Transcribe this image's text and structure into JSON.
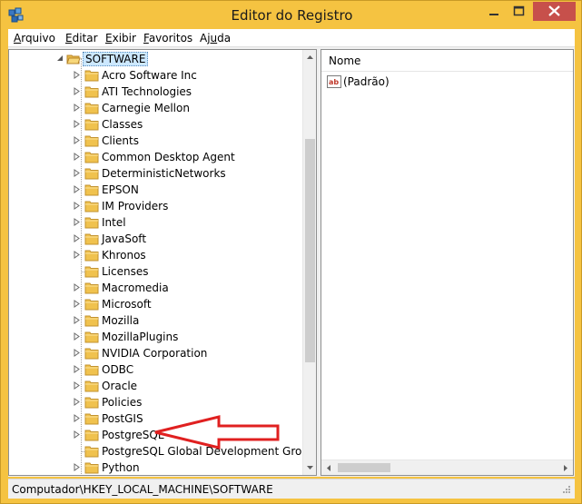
{
  "window": {
    "title": "Editor do Registro",
    "accent_color": "#f5c341",
    "close_color": "#c7504b"
  },
  "menu": [
    {
      "pre": "",
      "u": "A",
      "post": "rquivo"
    },
    {
      "pre": "",
      "u": "E",
      "post": "ditar"
    },
    {
      "pre": "",
      "u": "E",
      "post": "xibir"
    },
    {
      "pre": "",
      "u": "F",
      "post": "avoritos"
    },
    {
      "pre": "Aj",
      "u": "u",
      "post": "da"
    }
  ],
  "tree": {
    "root": {
      "label": "SOFTWARE",
      "expanded": true,
      "selected": true
    },
    "children": [
      {
        "label": "Acro Software Inc",
        "expandable": true
      },
      {
        "label": "ATI Technologies",
        "expandable": true
      },
      {
        "label": "Carnegie Mellon",
        "expandable": true
      },
      {
        "label": "Classes",
        "expandable": true
      },
      {
        "label": "Clients",
        "expandable": true
      },
      {
        "label": "Common Desktop Agent",
        "expandable": true
      },
      {
        "label": "DeterministicNetworks",
        "expandable": true
      },
      {
        "label": "EPSON",
        "expandable": true
      },
      {
        "label": "IM Providers",
        "expandable": true
      },
      {
        "label": "Intel",
        "expandable": true
      },
      {
        "label": "JavaSoft",
        "expandable": true
      },
      {
        "label": "Khronos",
        "expandable": true
      },
      {
        "label": "Licenses",
        "expandable": false
      },
      {
        "label": "Macromedia",
        "expandable": true
      },
      {
        "label": "Microsoft",
        "expandable": true
      },
      {
        "label": "Mozilla",
        "expandable": true
      },
      {
        "label": "MozillaPlugins",
        "expandable": true
      },
      {
        "label": "NVIDIA Corporation",
        "expandable": true
      },
      {
        "label": "ODBC",
        "expandable": true
      },
      {
        "label": "Oracle",
        "expandable": true
      },
      {
        "label": "Policies",
        "expandable": true
      },
      {
        "label": "PostGIS",
        "expandable": true
      },
      {
        "label": "PostgreSQL",
        "expandable": true
      },
      {
        "label": "PostgreSQL Global Development Group",
        "expandable": false
      },
      {
        "label": "Python",
        "expandable": true
      }
    ]
  },
  "values": {
    "column_name": "Nome",
    "rows": [
      {
        "name": "(Padrão)",
        "icon": "string-value-icon"
      }
    ]
  },
  "status": {
    "path": "Computador\\HKEY_LOCAL_MACHINE\\SOFTWARE"
  },
  "annotation": {
    "icon": "red-arrow-icon",
    "points_to": "Oracle",
    "color": "#e02020"
  }
}
